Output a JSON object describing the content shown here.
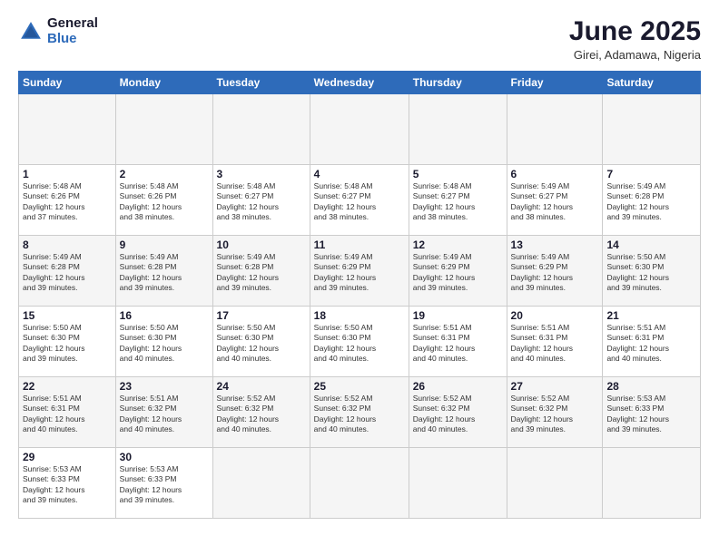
{
  "header": {
    "logo_general": "General",
    "logo_blue": "Blue",
    "month_title": "June 2025",
    "location": "Girei, Adamawa, Nigeria"
  },
  "calendar": {
    "days_of_week": [
      "Sunday",
      "Monday",
      "Tuesday",
      "Wednesday",
      "Thursday",
      "Friday",
      "Saturday"
    ],
    "weeks": [
      [
        {
          "day": "",
          "info": ""
        },
        {
          "day": "",
          "info": ""
        },
        {
          "day": "",
          "info": ""
        },
        {
          "day": "",
          "info": ""
        },
        {
          "day": "",
          "info": ""
        },
        {
          "day": "",
          "info": ""
        },
        {
          "day": "",
          "info": ""
        }
      ],
      [
        {
          "day": "1",
          "info": "Sunrise: 5:48 AM\nSunset: 6:26 PM\nDaylight: 12 hours\nand 37 minutes."
        },
        {
          "day": "2",
          "info": "Sunrise: 5:48 AM\nSunset: 6:26 PM\nDaylight: 12 hours\nand 38 minutes."
        },
        {
          "day": "3",
          "info": "Sunrise: 5:48 AM\nSunset: 6:27 PM\nDaylight: 12 hours\nand 38 minutes."
        },
        {
          "day": "4",
          "info": "Sunrise: 5:48 AM\nSunset: 6:27 PM\nDaylight: 12 hours\nand 38 minutes."
        },
        {
          "day": "5",
          "info": "Sunrise: 5:48 AM\nSunset: 6:27 PM\nDaylight: 12 hours\nand 38 minutes."
        },
        {
          "day": "6",
          "info": "Sunrise: 5:49 AM\nSunset: 6:27 PM\nDaylight: 12 hours\nand 38 minutes."
        },
        {
          "day": "7",
          "info": "Sunrise: 5:49 AM\nSunset: 6:28 PM\nDaylight: 12 hours\nand 39 minutes."
        }
      ],
      [
        {
          "day": "8",
          "info": "Sunrise: 5:49 AM\nSunset: 6:28 PM\nDaylight: 12 hours\nand 39 minutes."
        },
        {
          "day": "9",
          "info": "Sunrise: 5:49 AM\nSunset: 6:28 PM\nDaylight: 12 hours\nand 39 minutes."
        },
        {
          "day": "10",
          "info": "Sunrise: 5:49 AM\nSunset: 6:28 PM\nDaylight: 12 hours\nand 39 minutes."
        },
        {
          "day": "11",
          "info": "Sunrise: 5:49 AM\nSunset: 6:29 PM\nDaylight: 12 hours\nand 39 minutes."
        },
        {
          "day": "12",
          "info": "Sunrise: 5:49 AM\nSunset: 6:29 PM\nDaylight: 12 hours\nand 39 minutes."
        },
        {
          "day": "13",
          "info": "Sunrise: 5:49 AM\nSunset: 6:29 PM\nDaylight: 12 hours\nand 39 minutes."
        },
        {
          "day": "14",
          "info": "Sunrise: 5:50 AM\nSunset: 6:30 PM\nDaylight: 12 hours\nand 39 minutes."
        }
      ],
      [
        {
          "day": "15",
          "info": "Sunrise: 5:50 AM\nSunset: 6:30 PM\nDaylight: 12 hours\nand 39 minutes."
        },
        {
          "day": "16",
          "info": "Sunrise: 5:50 AM\nSunset: 6:30 PM\nDaylight: 12 hours\nand 40 minutes."
        },
        {
          "day": "17",
          "info": "Sunrise: 5:50 AM\nSunset: 6:30 PM\nDaylight: 12 hours\nand 40 minutes."
        },
        {
          "day": "18",
          "info": "Sunrise: 5:50 AM\nSunset: 6:30 PM\nDaylight: 12 hours\nand 40 minutes."
        },
        {
          "day": "19",
          "info": "Sunrise: 5:51 AM\nSunset: 6:31 PM\nDaylight: 12 hours\nand 40 minutes."
        },
        {
          "day": "20",
          "info": "Sunrise: 5:51 AM\nSunset: 6:31 PM\nDaylight: 12 hours\nand 40 minutes."
        },
        {
          "day": "21",
          "info": "Sunrise: 5:51 AM\nSunset: 6:31 PM\nDaylight: 12 hours\nand 40 minutes."
        }
      ],
      [
        {
          "day": "22",
          "info": "Sunrise: 5:51 AM\nSunset: 6:31 PM\nDaylight: 12 hours\nand 40 minutes."
        },
        {
          "day": "23",
          "info": "Sunrise: 5:51 AM\nSunset: 6:32 PM\nDaylight: 12 hours\nand 40 minutes."
        },
        {
          "day": "24",
          "info": "Sunrise: 5:52 AM\nSunset: 6:32 PM\nDaylight: 12 hours\nand 40 minutes."
        },
        {
          "day": "25",
          "info": "Sunrise: 5:52 AM\nSunset: 6:32 PM\nDaylight: 12 hours\nand 40 minutes."
        },
        {
          "day": "26",
          "info": "Sunrise: 5:52 AM\nSunset: 6:32 PM\nDaylight: 12 hours\nand 40 minutes."
        },
        {
          "day": "27",
          "info": "Sunrise: 5:52 AM\nSunset: 6:32 PM\nDaylight: 12 hours\nand 39 minutes."
        },
        {
          "day": "28",
          "info": "Sunrise: 5:53 AM\nSunset: 6:33 PM\nDaylight: 12 hours\nand 39 minutes."
        }
      ],
      [
        {
          "day": "29",
          "info": "Sunrise: 5:53 AM\nSunset: 6:33 PM\nDaylight: 12 hours\nand 39 minutes."
        },
        {
          "day": "30",
          "info": "Sunrise: 5:53 AM\nSunset: 6:33 PM\nDaylight: 12 hours\nand 39 minutes."
        },
        {
          "day": "",
          "info": ""
        },
        {
          "day": "",
          "info": ""
        },
        {
          "day": "",
          "info": ""
        },
        {
          "day": "",
          "info": ""
        },
        {
          "day": "",
          "info": ""
        }
      ]
    ]
  }
}
